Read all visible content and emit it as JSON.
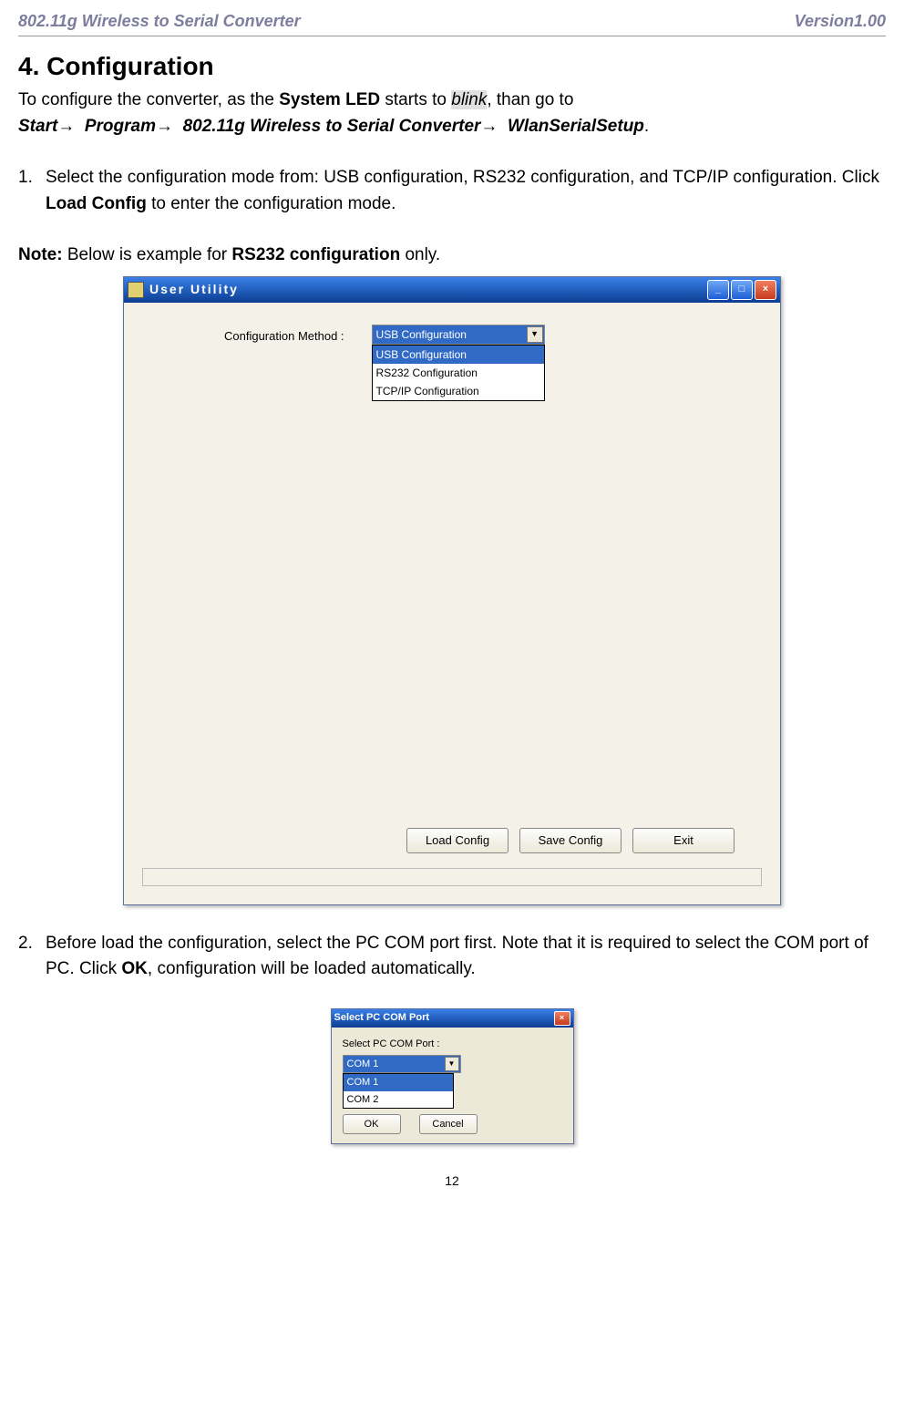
{
  "header": {
    "left": "802.11g Wireless to Serial Converter",
    "right": "Version1.00"
  },
  "section_title": "4. Configuration",
  "intro": {
    "p1a": "To configure the converter, as the ",
    "p1b": "System LED",
    "p1c": " starts to ",
    "blink": "blink",
    "p1d": ", than go to",
    "nav1": "Start",
    "arrow": "→",
    "nav2": "Program",
    "nav3": "802.11g Wireless to Serial Converter",
    "nav4": "WlanSerialSetup",
    "period": "."
  },
  "step1": {
    "num": "1.",
    "text_a": "Select the configuration mode from: USB configuration, RS232 configuration, and TCP/IP configuration. Click ",
    "load_config_bold": "Load Config",
    "text_b": " to enter the configuration mode."
  },
  "note": {
    "prefix": "Note:",
    "mid": " Below is example for ",
    "bold": "RS232 configuration",
    "suffix": " only."
  },
  "win1": {
    "title": "User Utility",
    "config_label": "Configuration Method :",
    "selected": "USB Configuration",
    "options": [
      "USB Configuration",
      "RS232 Configuration",
      "TCP/IP Configuration"
    ],
    "buttons": {
      "load": "Load Config",
      "save": "Save Config",
      "exit": "Exit"
    }
  },
  "step2": {
    "num": "2.",
    "text_a": "Before load the configuration, select the PC COM port first. Note that it is required to select the COM port of PC. Click ",
    "ok_bold": "OK",
    "text_b": ", configuration will be loaded automatically."
  },
  "win2": {
    "title": "Select PC COM Port",
    "label": "Select PC COM Port :",
    "selected": "COM 1",
    "options": [
      "COM 1",
      "COM 2"
    ],
    "buttons": {
      "ok": "OK",
      "cancel": "Cancel"
    }
  },
  "page_number": "12"
}
